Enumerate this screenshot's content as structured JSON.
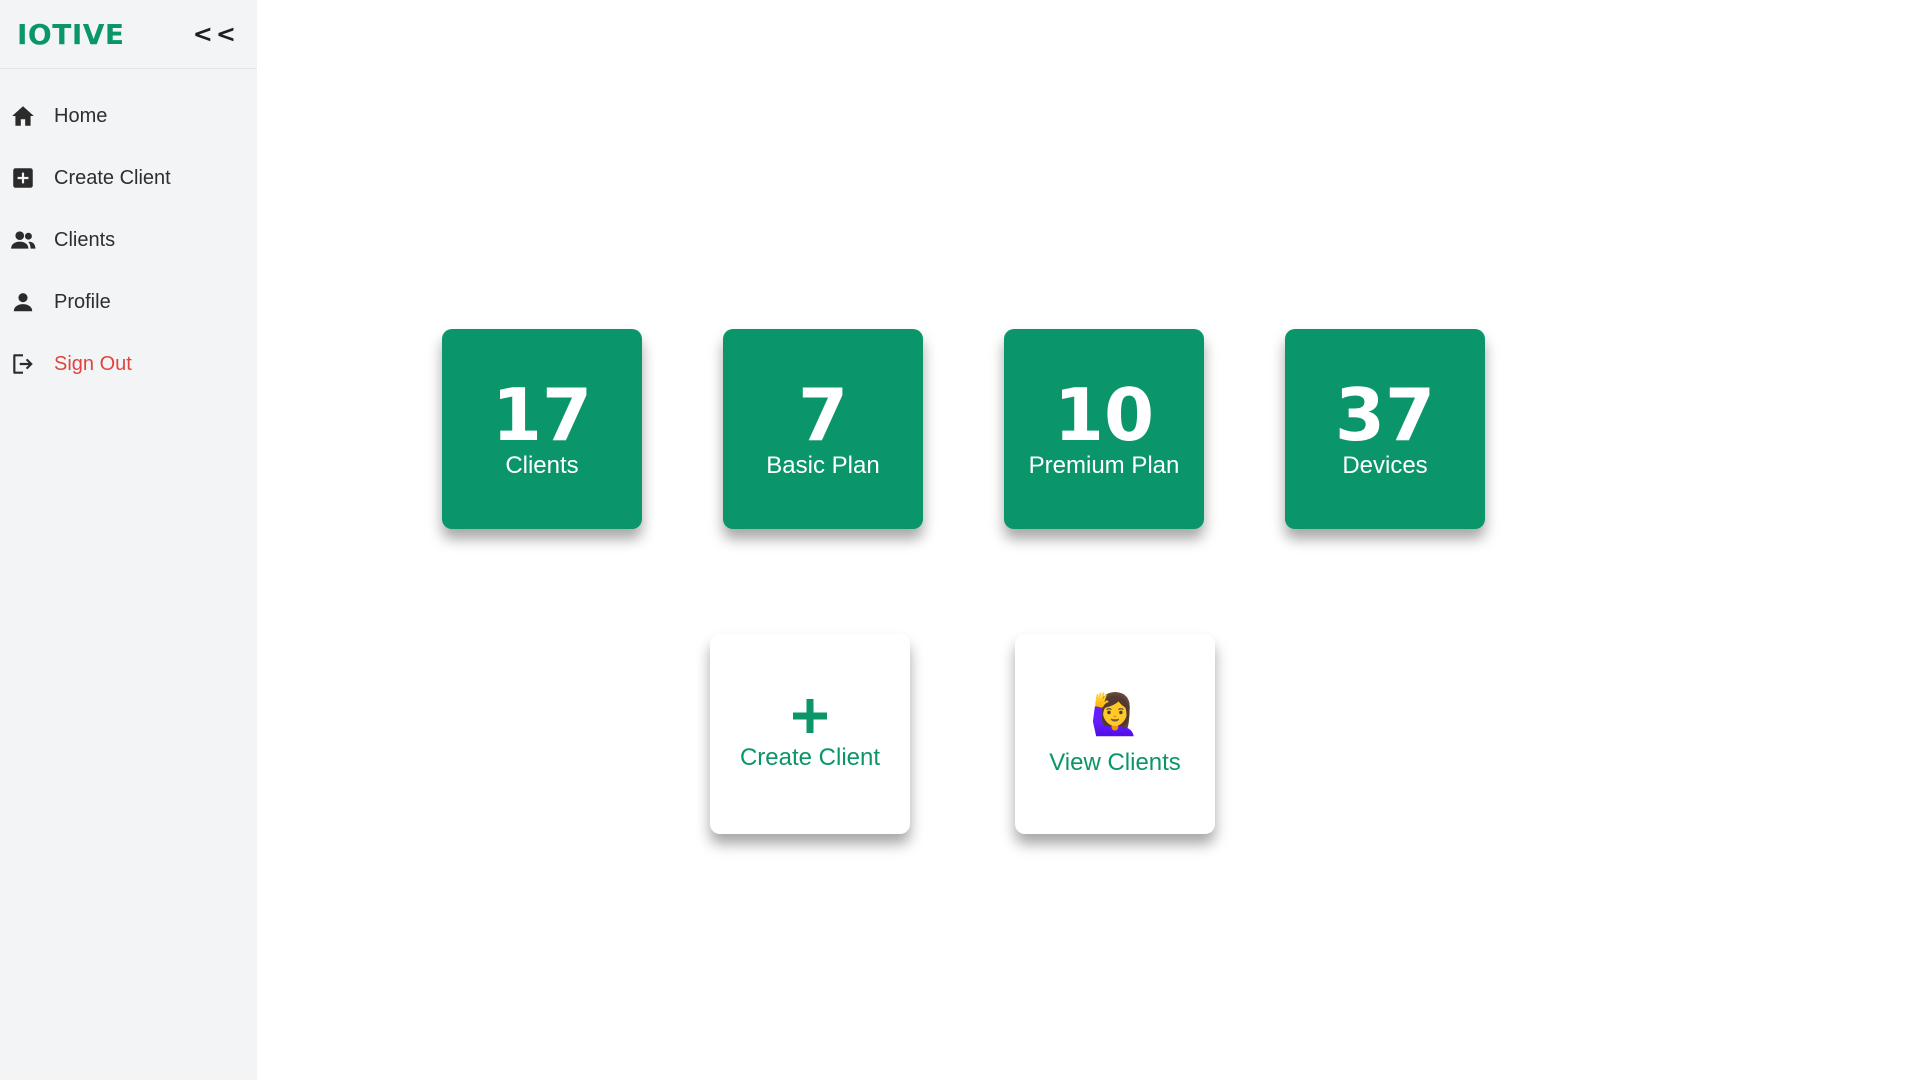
{
  "app": {
    "brand": "IOTIVE",
    "collapse_label": "<<"
  },
  "sidebar": {
    "items": [
      {
        "label": "Home",
        "icon": "home-icon"
      },
      {
        "label": "Create Client",
        "icon": "plus-square-icon"
      },
      {
        "label": "Clients",
        "icon": "people-icon"
      },
      {
        "label": "Profile",
        "icon": "person-icon"
      },
      {
        "label": "Sign Out",
        "icon": "sign-out-icon"
      }
    ]
  },
  "stats": [
    {
      "value": "17",
      "label": "Clients"
    },
    {
      "value": "7",
      "label": "Basic Plan"
    },
    {
      "value": "10",
      "label": "Premium Plan"
    },
    {
      "value": "37",
      "label": "Devices"
    }
  ],
  "actions": {
    "create": {
      "label": "Create Client",
      "icon": "plus-icon"
    },
    "view": {
      "label": "View Clients",
      "icon": "person-raising-hand-icon",
      "emoji": "🙋‍♀️"
    }
  },
  "colors": {
    "brand": "#0a9669",
    "card": "#0a966a",
    "danger": "#e0443e",
    "sidebar_bg": "#f3f4f6"
  }
}
